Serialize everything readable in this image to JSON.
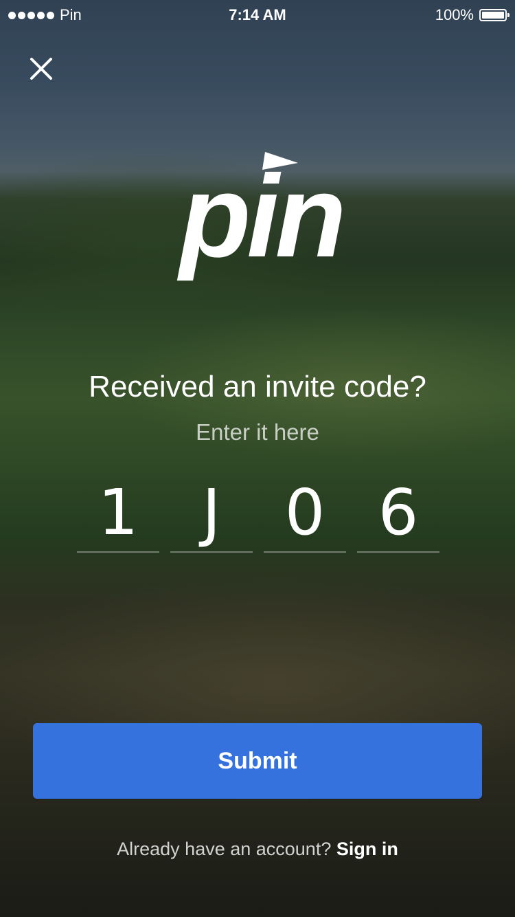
{
  "status_bar": {
    "carrier": "Pin",
    "time": "7:14 AM",
    "battery": "100%"
  },
  "header": {
    "close_icon": "close-icon"
  },
  "logo": {
    "text": "pin"
  },
  "content": {
    "title": "Received an invite code?",
    "subtitle": "Enter it here",
    "code": [
      "1",
      "J",
      "0",
      "6"
    ]
  },
  "actions": {
    "submit_label": "Submit",
    "signin_prompt": "Already have an account?",
    "signin_link": "Sign in"
  },
  "colors": {
    "accent": "#3572de"
  }
}
